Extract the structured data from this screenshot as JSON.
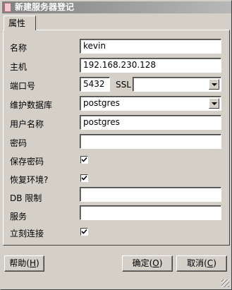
{
  "window": {
    "title": "新建服务器登记"
  },
  "tabs": [
    {
      "label": "属性"
    }
  ],
  "fields": {
    "name": {
      "label": "名称",
      "value": "kevin"
    },
    "host": {
      "label": "主机",
      "value": "192.168.230.128"
    },
    "port": {
      "label": "端口号",
      "value": "5432"
    },
    "ssl": {
      "label": "SSL",
      "value": ""
    },
    "maint_db": {
      "label": "维护数据库",
      "value": "postgres"
    },
    "username": {
      "label": "用户名称",
      "value": "postgres"
    },
    "password": {
      "label": "密码",
      "value": ""
    },
    "save_password": {
      "label": "保存密码",
      "checked": true
    },
    "restore_env": {
      "label": "恢复环境?",
      "checked": true
    },
    "db_restriction": {
      "label": "DB 限制",
      "value": ""
    },
    "service": {
      "label": "服务",
      "value": ""
    },
    "connect_now": {
      "label": "立刻连接",
      "checked": true
    }
  },
  "buttons": {
    "help": {
      "label": "帮助(",
      "mnemonic": "H",
      "suffix": ")"
    },
    "ok": {
      "label": "确定(",
      "mnemonic": "O",
      "suffix": ")"
    },
    "cancel": {
      "label": "取消(",
      "mnemonic": "C",
      "suffix": ")"
    }
  }
}
